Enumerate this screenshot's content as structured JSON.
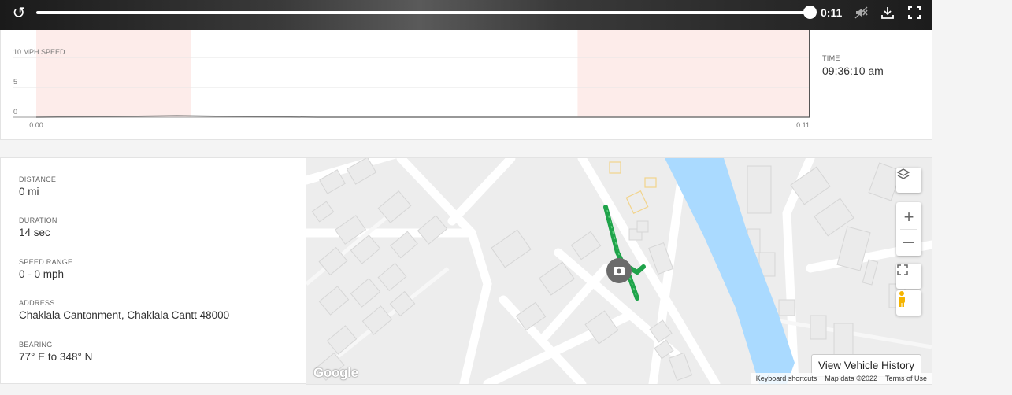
{
  "video": {
    "time": "0:11",
    "progress": 1.0,
    "icons": [
      "replay-icon",
      "sound-muted-icon",
      "download-icon",
      "fullscreen-icon"
    ]
  },
  "chart_data": {
    "type": "line",
    "ylabel": "10 MPH SPEED",
    "y_ticks": [
      "5",
      "0"
    ],
    "ylim": [
      0,
      10
    ],
    "x_tick_labels": [
      "0:00",
      "0:11"
    ],
    "xlim": [
      0,
      11
    ],
    "series": [
      {
        "x": [
          0,
          1,
          2,
          3,
          4,
          5,
          6,
          7,
          8,
          9,
          10,
          11
        ],
        "values": [
          0,
          0.1,
          0.25,
          0.1,
          0,
          0,
          0,
          0,
          0,
          0,
          0,
          0
        ]
      }
    ],
    "shaded_regions": [
      [
        0,
        2.2
      ],
      [
        7.7,
        11
      ]
    ],
    "shade_color": "#fdecea",
    "line_color": "#777777"
  },
  "time_panel": {
    "label": "TIME",
    "value": "09:36:10 am"
  },
  "info": [
    {
      "label": "DISTANCE",
      "value": "0 mi"
    },
    {
      "label": "DURATION",
      "value": "14 sec"
    },
    {
      "label": "SPEED RANGE",
      "value": "0 - 0 mph"
    },
    {
      "label": "ADDRESS",
      "value": "Chaklala Cantonment, Chaklala Cantt 48000"
    },
    {
      "label": "BEARING",
      "value": "77° E to 348° N"
    }
  ],
  "map": {
    "view_history_label": "View Vehicle History",
    "google_logo": "Google",
    "footer": {
      "shortcuts": "Keyboard shortcuts",
      "map_data": "Map data ©2022",
      "terms": "Terms of Use"
    },
    "controls": {
      "zoom_in": "+",
      "zoom_out": "—"
    },
    "route_color": "#1fa34a",
    "river_color": "#aadaff"
  }
}
